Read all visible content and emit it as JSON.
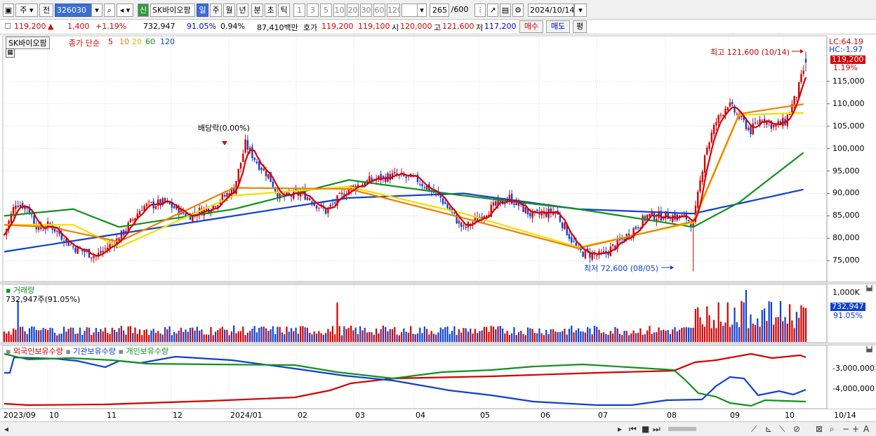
{
  "toolbar": {
    "period_main": "주",
    "prev": "전",
    "code": "326030",
    "stock_badge": "신",
    "stock_name": "SK바이오팜",
    "periods": [
      "일",
      "주",
      "월",
      "년",
      "분",
      "초",
      "틱"
    ],
    "active_period": "일",
    "intervals": [
      "1",
      "3",
      "5",
      "10",
      "20",
      "30",
      "60",
      "120"
    ],
    "count": "265",
    "count_total": "/600",
    "date": "2024/10/14"
  },
  "quote": {
    "price": "119,200",
    "change": "1,400",
    "change_pct": "+1.19%",
    "volume": "732,947",
    "vol_ratio": "91.05%",
    "turnover": "0.94%",
    "amount": "87,410백만",
    "bid_label": "호가",
    "bid1": "119,200",
    "bid2": "119,100",
    "open_label": "시",
    "open": "120,000",
    "high_label": "고",
    "high": "121,600",
    "low_label": "저",
    "low": "117,200",
    "buy": "매수",
    "sell": "매도",
    "avg": "평",
    "up_color": "#d60000",
    "down_color": "#0000d6"
  },
  "price_panel": {
    "stock_tag": "SK바이오팜",
    "legend_prefix": "종가 단순",
    "ma_periods": [
      "5",
      "10",
      "20",
      "60",
      "120"
    ],
    "ma_colors": [
      "#d40000",
      "#f08000",
      "#f0e000",
      "#139020",
      "#1040d0"
    ],
    "lc": "LC:64.19",
    "hc": "HC:-1.97",
    "price_tag": "119,200",
    "pct_tag": "1.19%",
    "high_note": "최고 121,600 (10/14)",
    "low_note": "최저 72,600 (08/05)",
    "dividend_note": "배당락(0.00%)"
  },
  "volume_panel": {
    "title": "거래량",
    "current": "732,947주(91.05%)",
    "axis_label": "1,000K",
    "tag_value": "732,947",
    "tag_pct": "91.05%"
  },
  "holder_panel": {
    "series": [
      "외국인보유수량",
      "기관보유수량",
      "개인보유수량"
    ],
    "colors": [
      "#d40000",
      "#1040d0",
      "#139020"
    ],
    "axis_labels": [
      "-3,000,000",
      "-4,000,000"
    ]
  },
  "x_axis": {
    "labels": [
      "2023/09",
      "10",
      "11",
      "12",
      "2024/01",
      "02",
      "03",
      "04",
      "05",
      "06",
      "07",
      "08",
      "09",
      "10"
    ],
    "end_label": "10/14"
  },
  "chart_data": {
    "type": "candlestick",
    "y_axis_ticks": [
      75000,
      80000,
      85000,
      90000,
      95000,
      100000,
      105000,
      110000,
      115000
    ],
    "y_axis_labels": [
      "75,000",
      "80,000",
      "85,000",
      "90,000",
      "95,000",
      "100,000",
      "105,000",
      "110,000",
      "115,000"
    ],
    "ylim": [
      70500,
      125000
    ],
    "x_range": [
      "2023/09",
      "2024/10/14"
    ],
    "close_path_anchors": [
      [
        0,
        80800
      ],
      [
        5,
        88000
      ],
      [
        10,
        87000
      ],
      [
        15,
        82000
      ],
      [
        20,
        83000
      ],
      [
        30,
        78000
      ],
      [
        40,
        76000
      ],
      [
        50,
        80000
      ],
      [
        60,
        87000
      ],
      [
        70,
        88000
      ],
      [
        80,
        85000
      ],
      [
        90,
        87000
      ],
      [
        100,
        91000
      ],
      [
        105,
        101000
      ],
      [
        110,
        97000
      ],
      [
        115,
        94000
      ],
      [
        120,
        89000
      ],
      [
        130,
        90000
      ],
      [
        140,
        86000
      ],
      [
        150,
        91000
      ],
      [
        160,
        93000
      ],
      [
        170,
        94000
      ],
      [
        180,
        93000
      ],
      [
        190,
        89000
      ],
      [
        200,
        82000
      ],
      [
        210,
        86000
      ],
      [
        220,
        89000
      ],
      [
        230,
        85000
      ],
      [
        240,
        86000
      ],
      [
        250,
        77000
      ],
      [
        260,
        76000
      ],
      [
        270,
        80000
      ],
      [
        280,
        85000
      ],
      [
        290,
        85000
      ],
      [
        297,
        84500
      ],
      [
        300,
        83000
      ],
      [
        305,
        99000
      ],
      [
        310,
        106000
      ],
      [
        315,
        110000
      ],
      [
        320,
        107000
      ],
      [
        325,
        104000
      ],
      [
        330,
        107000
      ],
      [
        335,
        105000
      ],
      [
        340,
        106000
      ],
      [
        345,
        112000
      ],
      [
        349,
        119200
      ]
    ],
    "ma5_anchors": [
      [
        0,
        83000
      ],
      [
        20,
        82000
      ],
      [
        50,
        80500
      ],
      [
        100,
        93000
      ],
      [
        150,
        90500
      ],
      [
        200,
        83500
      ],
      [
        250,
        77500
      ],
      [
        300,
        84000
      ],
      [
        320,
        108000
      ],
      [
        349,
        112000
      ]
    ],
    "ma20_anchors": [
      [
        0,
        83000
      ],
      [
        30,
        83000
      ],
      [
        50,
        78000
      ],
      [
        100,
        89500
      ],
      [
        150,
        91500
      ],
      [
        200,
        85500
      ],
      [
        250,
        78000
      ],
      [
        300,
        83500
      ],
      [
        320,
        107500
      ],
      [
        349,
        108000
      ]
    ],
    "ma60_anchors": [
      [
        0,
        85000
      ],
      [
        30,
        86500
      ],
      [
        50,
        82500
      ],
      [
        100,
        86500
      ],
      [
        150,
        93000
      ],
      [
        200,
        89500
      ],
      [
        250,
        86500
      ],
      [
        300,
        82500
      ],
      [
        320,
        88000
      ],
      [
        349,
        99500
      ]
    ],
    "ma120_anchors": [
      [
        0,
        77000
      ],
      [
        50,
        81000
      ],
      [
        100,
        85000
      ],
      [
        150,
        89000
      ],
      [
        200,
        90000
      ],
      [
        250,
        86500
      ],
      [
        300,
        85500
      ],
      [
        349,
        91000
      ]
    ],
    "high": {
      "value": 121600,
      "date": "10/14"
    },
    "low": {
      "value": 72600,
      "date": "08/05"
    }
  }
}
